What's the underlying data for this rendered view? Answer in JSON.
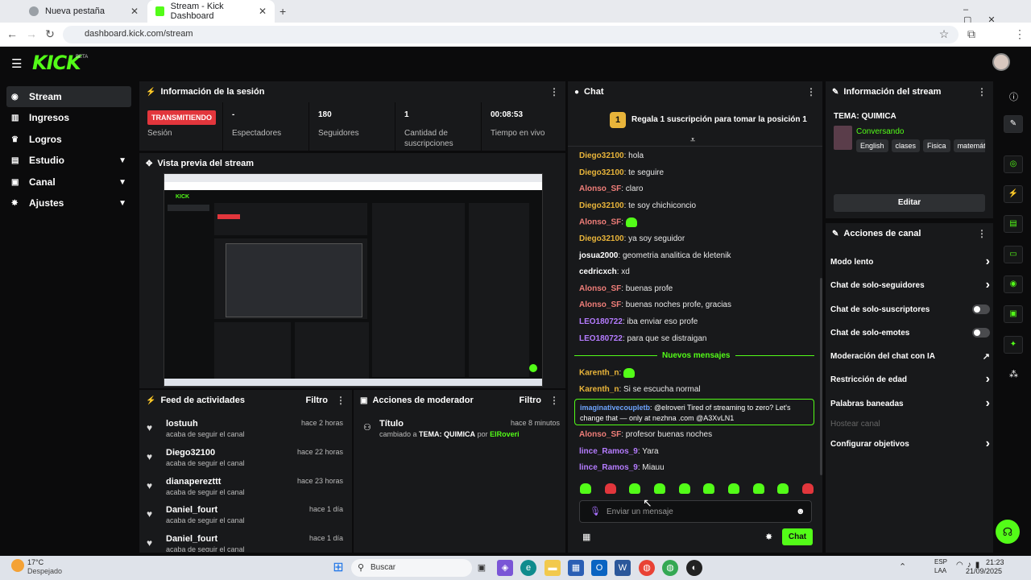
{
  "browser": {
    "tabs": [
      {
        "title": "Nueva pestaña"
      },
      {
        "title": "Stream - Kick Dashboard"
      }
    ],
    "url": "dashboard.kick.com/stream"
  },
  "header": {
    "logo": "KICK",
    "beta": "BETA"
  },
  "sidebar": {
    "items": [
      {
        "label": "Stream",
        "icon": "stream-icon"
      },
      {
        "label": "Ingresos",
        "icon": "chart-icon"
      },
      {
        "label": "Logros",
        "icon": "trophy-icon"
      },
      {
        "label": "Estudio",
        "icon": "studio-icon"
      },
      {
        "label": "Canal",
        "icon": "channel-icon"
      },
      {
        "label": "Ajustes",
        "icon": "gear-icon"
      }
    ]
  },
  "session": {
    "title": "Información de la sesión",
    "status_badge": "TRANSMITIENDO",
    "status_label": "Sesión",
    "stats": [
      {
        "value": "-",
        "label": "Espectadores"
      },
      {
        "value": "180",
        "label": "Seguidores"
      },
      {
        "value": "1",
        "label": "Cantidad de suscripciones"
      },
      {
        "value": "00:08:53",
        "label": "Tiempo en vivo"
      }
    ]
  },
  "preview": {
    "title": "Vista previa del stream"
  },
  "feed": {
    "title": "Feed de actividades",
    "filter": "Filtro",
    "items": [
      {
        "name": "lostuuh",
        "desc": "acaba de seguir el canal",
        "time": "hace 2 horas"
      },
      {
        "name": "Diego32100",
        "desc": "acaba de seguir el canal",
        "time": "hace 22 horas"
      },
      {
        "name": "dianaperezttt",
        "desc": "acaba de seguir el canal",
        "time": "hace 23 horas"
      },
      {
        "name": "Daniel_fourt",
        "desc": "acaba de seguir el canal",
        "time": "hace 1 día"
      },
      {
        "name": "Daniel_fourt",
        "desc": "acaba de seguir el canal",
        "time": "hace 1 día"
      }
    ]
  },
  "mod": {
    "title": "Acciones de moderador",
    "filter": "Filtro",
    "item": {
      "title": "Título",
      "prefix": "cambiado a",
      "topic": "TEMA: QUIMICA",
      "by": "por",
      "user": "ElRoveri",
      "time": "hace 8 minutos"
    }
  },
  "chat": {
    "title": "Chat",
    "pinned": "Regala 1 suscripción para tomar la posición 1",
    "pinned_rank": "1",
    "new_messages": "Nuevos mensajes",
    "messages": [
      {
        "user": "Diego32100",
        "text": "hola",
        "c": "u-y"
      },
      {
        "user": "Diego32100",
        "text": "te seguire",
        "c": "u-y"
      },
      {
        "user": "Alonso_SF",
        "text": "claro",
        "c": "u-p"
      },
      {
        "user": "Diego32100",
        "text": "te soy chichiconcio",
        "c": "u-y"
      },
      {
        "user": "Alonso_SF",
        "text": "",
        "c": "u-p",
        "emote": true
      },
      {
        "user": "Diego32100",
        "text": "ya soy seguidor",
        "c": "u-y"
      },
      {
        "user": "josua2000",
        "text": "geometria analitica de kletenik",
        "c": "u-w"
      },
      {
        "user": "cedricxch",
        "text": "xd",
        "c": "u-w"
      },
      {
        "user": "Alonso_SF",
        "text": "buenas profe",
        "c": "u-p"
      },
      {
        "user": "Alonso_SF",
        "text": "buenas noches profe, gracias",
        "c": "u-p"
      },
      {
        "user": "LEO180722",
        "text": "iba enviar eso profe",
        "c": "u-v"
      },
      {
        "user": "LEO180722",
        "text": "para que se distraigan",
        "c": "u-v"
      }
    ],
    "new": [
      {
        "user": "Karenth_n",
        "text": "",
        "c": "u-y",
        "emote": true
      },
      {
        "user": "Karenth_n",
        "text": "Si se escucha normal",
        "c": "u-y"
      }
    ],
    "spam": {
      "user": "imaginativecoupletb",
      "text1": "@elroveri Tired of streaming to zero? Let's",
      "text2": "change that — only at nezhna .com @A3XvLN1"
    },
    "after": [
      {
        "user": "Alonso_SF",
        "text": "profesor buenas noches",
        "c": "u-p"
      },
      {
        "user": "lince_Ramos_9",
        "text": "Yara",
        "c": "u-v"
      },
      {
        "user": "lince_Ramos_9",
        "text": "Miauu",
        "c": "u-v"
      }
    ],
    "input_placeholder": "Enviar un mensaje",
    "send": "Chat"
  },
  "streaminfo": {
    "title": "Información del stream",
    "topic": "TEMA: QUIMICA",
    "category": "Conversando",
    "tags": [
      "English",
      "clases",
      "Fisica",
      "matemát"
    ],
    "edit": "Editar"
  },
  "actions": {
    "title": "Acciones de canal",
    "items": [
      {
        "label": "Modo lento",
        "kind": "arrow"
      },
      {
        "label": "Chat de solo-seguidores",
        "kind": "arrow"
      },
      {
        "label": "Chat de solo-suscriptores",
        "kind": "toggle"
      },
      {
        "label": "Chat de solo-emotes",
        "kind": "toggle"
      },
      {
        "label": "Moderación del chat con IA",
        "kind": "ext"
      },
      {
        "label": "Restricción de edad",
        "kind": "arrow"
      },
      {
        "label": "Palabras baneadas",
        "kind": "arrow"
      },
      {
        "label": "Hostear canal",
        "kind": "disabled"
      },
      {
        "label": "Configurar objetivos",
        "kind": "arrow"
      }
    ]
  },
  "taskbar": {
    "weather": "17°C",
    "weather_desc": "Despejado",
    "search": "Buscar",
    "lang": "ESP",
    "lang2": "LAA",
    "time": "21:23",
    "date": "21/09/2025"
  },
  "colors": {
    "accent": "#53fc18",
    "live": "#e2363c"
  }
}
